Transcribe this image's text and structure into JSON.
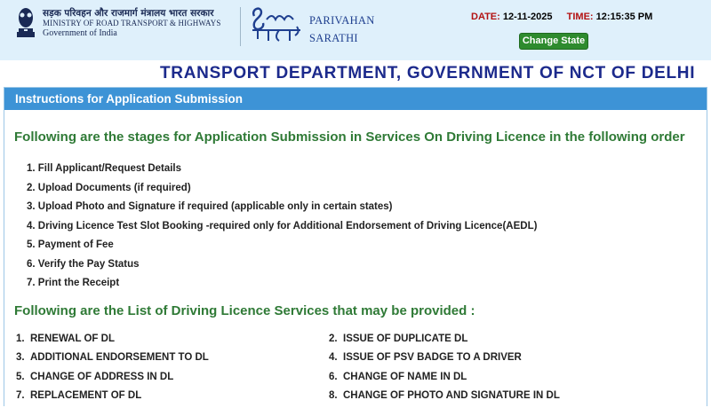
{
  "header": {
    "ministry_hindi": "सड़क परिवहन और राजमार्ग मंत्रालय भारत सरकार",
    "ministry_english": "MINISTRY OF ROAD TRANSPORT & HIGHWAYS",
    "government": "Government of India",
    "logo_icon": "sarathi-logo",
    "brand_line1": "PARIVAHAN",
    "brand_line2": "SARATHI",
    "date_label": "DATE:",
    "date_value": "12-11-2025",
    "time_label": "TIME:",
    "time_value": "12:15:35 PM",
    "change_state_label": "Change State"
  },
  "department_title": "TRANSPORT DEPARTMENT, GOVERNMENT OF NCT OF DELHI",
  "panel": {
    "title": "Instructions for Application Submission",
    "stages_heading": "Following are the stages for Application Submission in Services On Driving Licence in the following order",
    "stages": [
      "1. Fill Applicant/Request Details",
      "2. Upload Documents (if required)",
      "3. Upload Photo and Signature if required (applicable only in certain states)",
      "4. Driving Licence Test Slot Booking -required only for Additional Endorsement of Driving Licence(AEDL)",
      "5. Payment of Fee",
      "6. Verify the Pay Status",
      "7. Print the Receipt"
    ],
    "services_heading": "Following are the List of Driving Licence Services that may be provided :",
    "services_left": [
      {
        "num": "1.",
        "label": "RENEWAL OF DL"
      },
      {
        "num": "3.",
        "label": "ADDITIONAL ENDORSEMENT TO DL"
      },
      {
        "num": "5.",
        "label": "CHANGE OF ADDRESS IN DL"
      },
      {
        "num": "7.",
        "label": "REPLACEMENT OF DL"
      }
    ],
    "services_right": [
      {
        "num": "2.",
        "label": "ISSUE OF DUPLICATE DL"
      },
      {
        "num": "4.",
        "label": "ISSUE OF PSV BADGE TO A DRIVER"
      },
      {
        "num": "6.",
        "label": "CHANGE OF NAME IN DL"
      },
      {
        "num": "8.",
        "label": "CHANGE OF PHOTO AND SIGNATURE IN DL"
      }
    ]
  },
  "colors": {
    "header_bg": "#dff0fb",
    "dept_title": "#1c2a8c",
    "panel_head": "#3d93d6",
    "heading_green": "#2f7a36",
    "label_red": "#b31212",
    "button_green": "#2e8b2e"
  }
}
